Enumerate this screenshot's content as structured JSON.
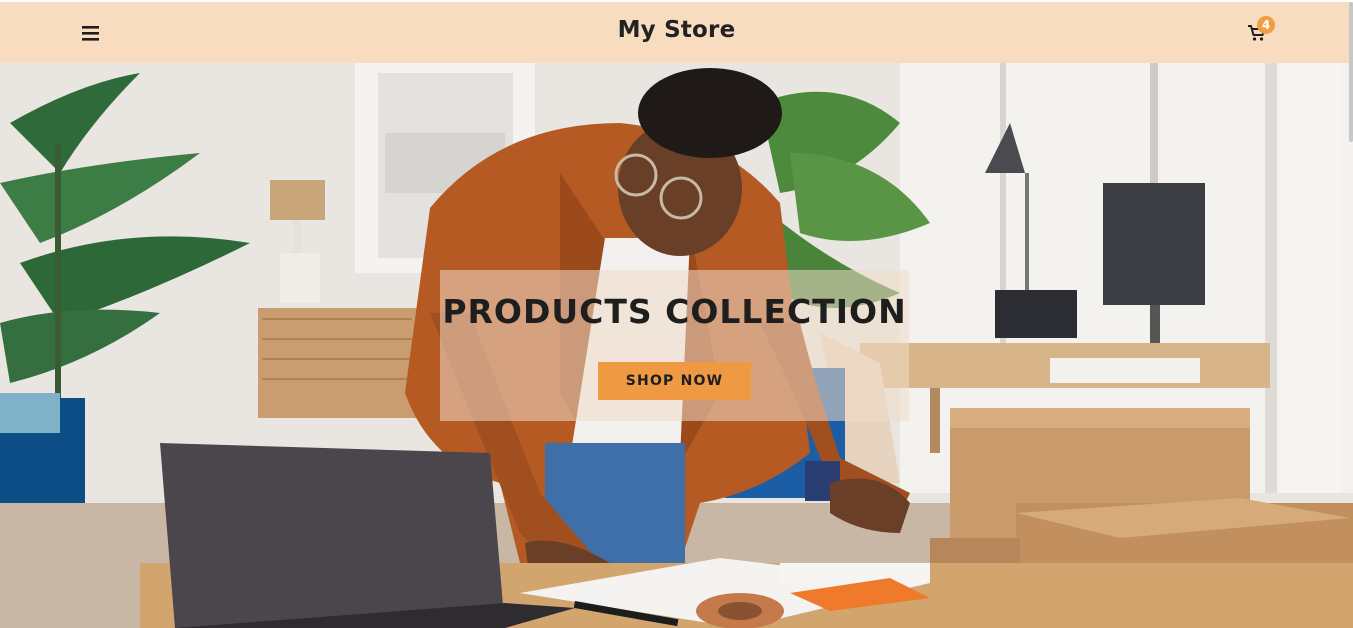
{
  "header": {
    "title": "My Store",
    "menu_icon": "hamburger-menu-icon",
    "cart_icon": "shopping-cart-icon",
    "cart_count": "4",
    "background_color": "#f7dcc0",
    "badge_color": "#f0a040"
  },
  "hero": {
    "heading": "PRODUCTS COLLECTION",
    "button_label": "SHOP NOW",
    "button_color": "#ef9a43",
    "image_description_icon": "hero-photo"
  }
}
